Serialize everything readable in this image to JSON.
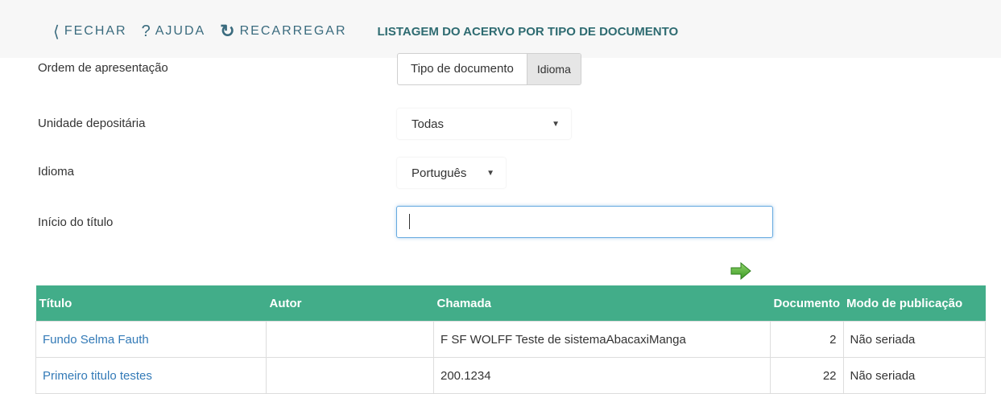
{
  "toolbar": {
    "close_label": "FECHAR",
    "close_icon": "chevron-left-icon",
    "help_label": "AJUDA",
    "help_icon": "question-icon",
    "reload_label": "RECARREGAR",
    "reload_icon": "reload-icon",
    "page_title": "LISTAGEM DO ACERVO POR TIPO DE DOCUMENTO"
  },
  "form": {
    "order_label": "Ordem de apresentação",
    "order_options": [
      "Tipo de documento",
      "Idioma"
    ],
    "order_selected": "Idioma",
    "unit_label": "Unidade depositária",
    "unit_value": "Todas",
    "language_label": "Idioma",
    "language_value": "Português",
    "title_start_label": "Início do título",
    "title_start_value": ""
  },
  "colors": {
    "table_header": "#42ad89",
    "link": "#337ab7",
    "toolbar_text": "#3a6b7e",
    "go_arrow": "#5cb83c"
  },
  "table": {
    "headers": [
      "Título",
      "Autor",
      "Chamada",
      "Documento",
      "Modo de publicação"
    ],
    "rows": [
      {
        "titulo": "Fundo Selma Fauth",
        "autor": "",
        "chamada": "F SF WOLFF Teste de sistemaAbacaxiManga",
        "documento": "2",
        "modo": "Não seriada"
      },
      {
        "titulo": "Primeiro titulo testes",
        "autor": "",
        "chamada": "200.1234",
        "documento": "22",
        "modo": "Não seriada"
      }
    ]
  }
}
